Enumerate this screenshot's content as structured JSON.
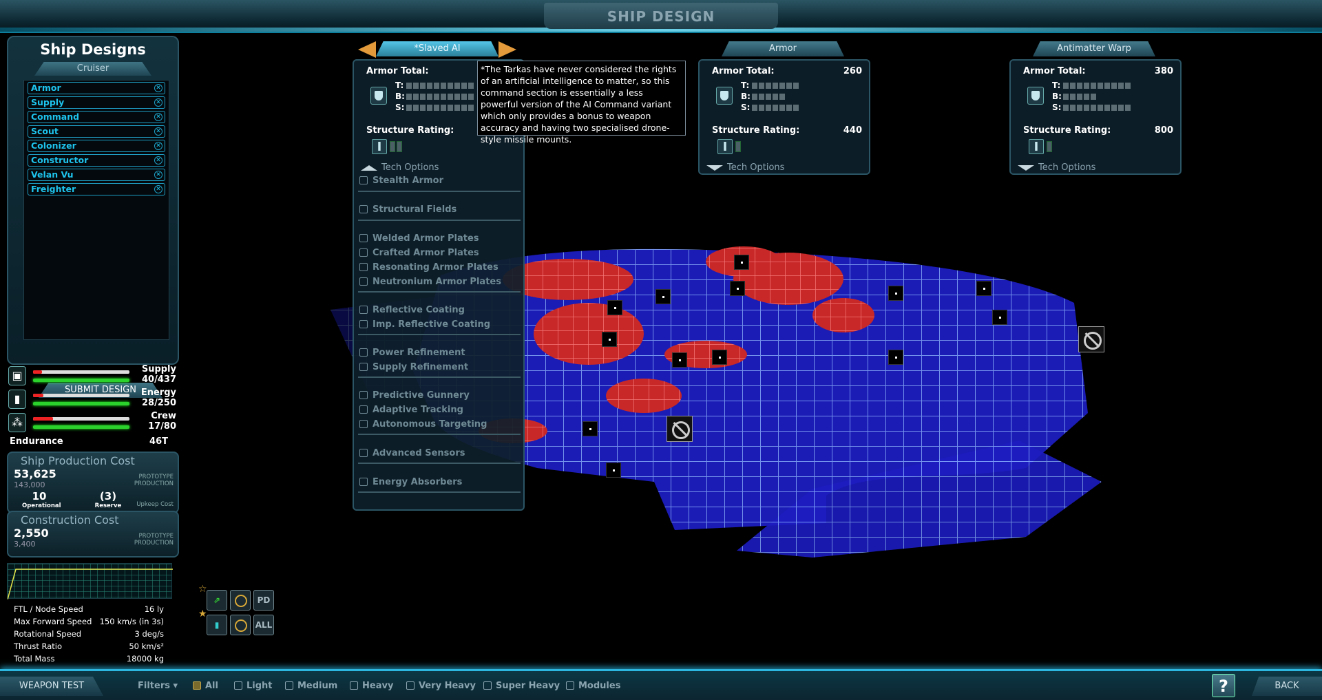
{
  "header": {
    "title": "SHIP DESIGN"
  },
  "left": {
    "title": "Ship Designs",
    "class_tab": "Cruiser",
    "designs": [
      "Armor",
      "Supply",
      "Command",
      "Scout",
      "Colonizer",
      "Constructor",
      "Velan Vu",
      "Freighter"
    ],
    "submit_label": "SUBMIT DESIGN"
  },
  "resources": [
    {
      "name": "Supply",
      "value": "40/437",
      "used_fraction": 0.09,
      "icon": "supply-crate-icon"
    },
    {
      "name": "Energy",
      "value": "28/250",
      "used_fraction": 0.11,
      "icon": "battery-icon"
    },
    {
      "name": "Crew",
      "value": "17/80",
      "used_fraction": 0.21,
      "icon": "crew-icon"
    }
  ],
  "endurance": {
    "label": "Endurance",
    "value": "46T"
  },
  "production": {
    "title": "Ship Production Cost",
    "value": "53,625",
    "prototype": "143,000",
    "tag": "PROTOTYPE PRODUCTION",
    "operational": "10",
    "operational_label": "Operational",
    "reserve": "(3)",
    "reserve_label": "Reserve",
    "upkeep_label": "Upkeep Cost"
  },
  "construction": {
    "title": "Construction Cost",
    "value": "2,550",
    "prototype": "3,400",
    "tag": "PROTOTYPE PRODUCTION"
  },
  "stats": [
    {
      "label": "FTL / Node Speed",
      "value": "16 ly"
    },
    {
      "label": "Max Forward Speed",
      "value": "150 km/s (in 3s)"
    },
    {
      "label": "Rotational Speed",
      "value": "3 deg/s"
    },
    {
      "label": "Thrust Ratio",
      "value": "50 km/s²"
    },
    {
      "label": "Total Mass",
      "value": "18000 kg"
    }
  ],
  "panels": {
    "slaved": {
      "tab": "*Slaved AI",
      "armor_total_label": "Armor Total:",
      "structure_label": "Structure Rating:",
      "tech_options": "Tech Options"
    },
    "armor": {
      "tab": "Armor",
      "armor_total_label": "Armor Total:",
      "armor_total": "260",
      "structure_label": "Structure Rating:",
      "structure": "440",
      "tech_options": "Tech Options"
    },
    "warp": {
      "tab": "Antimatter Warp",
      "armor_total_label": "Armor Total:",
      "armor_total": "380",
      "structure_label": "Structure Rating:",
      "structure": "800",
      "tech_options": "Tech Options"
    },
    "tbs": {
      "t": "T:",
      "b": "B:",
      "s": "S:"
    }
  },
  "tooltip": "*The Tarkas have never considered the rights of an artificial intelligence to matter, so this command section is essentially a less powerful version of the AI Command variant which only provides a bonus to weapon accuracy and having two specialised drone-style missile mounts.",
  "techs": [
    "Stealth Armor",
    "Structural Fields",
    "Welded Armor Plates",
    "Crafted Armor Plates",
    "Resonating Armor Plates",
    "Neutronium Armor Plates",
    "Reflective Coating",
    "Imp. Reflective Coating",
    "Power Refinement",
    "Supply Refinement",
    "Predictive Gunnery",
    "Adaptive Tracking",
    "Autonomous Targeting",
    "Advanced Sensors",
    "Energy Absorbers"
  ],
  "weapon_selector": {
    "pd": "PD",
    "all": "ALL"
  },
  "bottom": {
    "weapon_test": "WEAPON TEST",
    "filters": "Filters",
    "filter_items": [
      "All",
      "Light",
      "Medium",
      "Heavy",
      "Very Heavy",
      "Super Heavy",
      "Modules"
    ],
    "help": "?",
    "back": "BACK"
  },
  "colors": {
    "accent": "#1ec4ee",
    "panel": "#0e202a",
    "ship_hull": "#2020c8",
    "ship_mount": "#d83232"
  }
}
